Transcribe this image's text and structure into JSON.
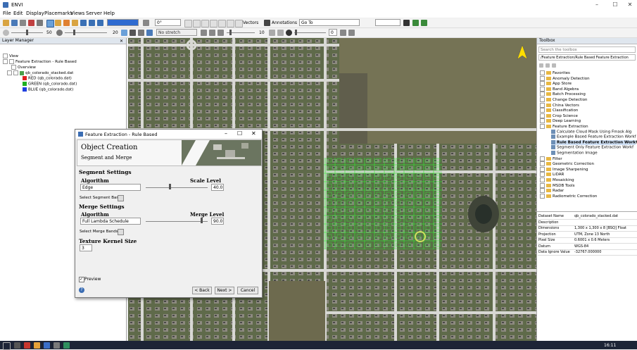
{
  "app": {
    "title": "ENVI"
  },
  "menu": [
    "File",
    "Edit",
    "Display",
    "Placemarks",
    "Views",
    "Server",
    "Help"
  ],
  "toolbar": {
    "rotation_value": "0°",
    "vectors_label": "Vectors",
    "annotations_label": "Annotations",
    "goto_value": "Go To",
    "brightness_value": "50",
    "contrast_value": "20",
    "stretch_value": "No stretch",
    "sharpen_value": "10",
    "transparency_value": "0"
  },
  "layer_manager": {
    "title": "Layer Manager",
    "items": [
      "View",
      "Feature Extraction - Rule Based",
      "Overview",
      "qb_colorado_stacked.dat",
      "RED (qb_colorado.dat)",
      "GREEN (qb_colorado.dat)",
      "BLUE (qb_colorado.dat)"
    ]
  },
  "toolbox": {
    "title": "Toolbox",
    "search_placeholder": "Search the toolbox",
    "path": "/Feature Extraction/Rule Based Feature Extraction",
    "folders": [
      "Favorites",
      "Anomaly Detection",
      "App Store",
      "Band Algebra",
      "Batch Processing",
      "Change Detection",
      "China Vectors",
      "Classification",
      "Crop Science",
      "Deep Learning",
      "Feature Extraction"
    ],
    "tools": [
      "Calculate Cloud Mask Using Fmask Alg",
      "Example Based Feature Extraction Workf",
      "Rule Based Feature Extraction Workfl",
      "Segment Only Feature Extraction Workf",
      "Segmentation Image"
    ],
    "folders2": [
      "Filter",
      "Geometric Correction",
      "Image Sharpening",
      "LiDAR",
      "Mosaicking",
      "MSDB Tools",
      "Radar",
      "Radiometric Correction"
    ],
    "info": [
      {
        "k": "Dataset Name",
        "v": "qb_colorado_stacked.dat"
      },
      {
        "k": "Description",
        "v": ""
      },
      {
        "k": "Dimensions",
        "v": "1,300 x 1,300 x 8 [BSQ] Float"
      },
      {
        "k": "Projection",
        "v": "UTM, Zone 13 North"
      },
      {
        "k": "Pixel Size",
        "v": "0.6001 x 0.6 Meters"
      },
      {
        "k": "Datum",
        "v": "WGS-84"
      },
      {
        "k": "Data Ignore Value",
        "v": "-32767.000000"
      }
    ]
  },
  "dialog": {
    "title": "Feature Extraction - Rule Based",
    "header_title": "Object Creation",
    "header_subtitle": "Segment and Merge",
    "segment_settings": "Segment Settings",
    "algorithm_label": "Algorithm",
    "segment_algorithm": "Edge",
    "scale_level_label": "Scale Level",
    "scale_level_value": "40.0",
    "select_segment_bands": "Select Segment Bands",
    "merge_settings": "Merge Settings",
    "merge_algorithm": "Full Lambda Schedule",
    "merge_level_label": "Merge Level",
    "merge_level_value": "90.0",
    "select_merge_bands": "Select Merge Bands",
    "texture_kernel_label": "Texture Kernel Size",
    "texture_kernel_value": "3",
    "preview_label": "Preview",
    "back_label": "< Back",
    "next_label": "Next >",
    "cancel_label": "Cancel",
    "help_label": "?"
  },
  "taskbar": {
    "time": "16:11"
  },
  "colors": {
    "accent": "#3b6db3",
    "segment_highlight": "#33ff33"
  }
}
